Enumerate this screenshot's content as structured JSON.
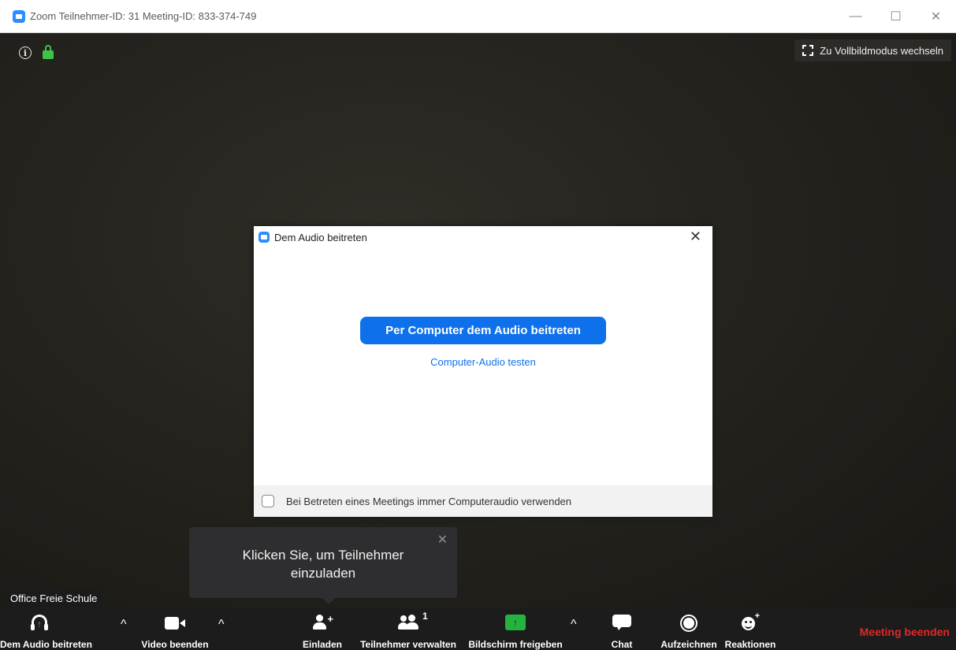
{
  "window": {
    "title": "Zoom Teilnehmer-ID: 31   Meeting-ID: 833-374-749",
    "minimize": "—",
    "maximize": "☐",
    "close": "✕"
  },
  "video": {
    "fullscreen_label": "Zu Vollbildmodus wechseln",
    "participant_name": "Office Freie Schule",
    "info_glyph": "i"
  },
  "tooltip": {
    "text": "Klicken Sie, um Teilnehmer einzuladen",
    "close": "✕"
  },
  "dialog": {
    "title": "Dem Audio beitreten",
    "close": "✕",
    "join_button": "Per Computer dem Audio beitreten",
    "test_link": "Computer-Audio testen",
    "checkbox_label": "Bei Betreten eines Meetings immer Computeraudio verwenden",
    "checkbox_checked": false
  },
  "toolbar": {
    "join_audio": "Dem Audio beitreten",
    "video": "Video beenden",
    "invite": "Einladen",
    "participants": "Teilnehmer verwalten",
    "participant_count": "1",
    "share": "Bildschirm freigeben",
    "chat": "Chat",
    "record": "Aufzeichnen",
    "reactions": "Reaktionen",
    "end_meeting": "Meeting beenden",
    "caret": "^"
  },
  "colors": {
    "accent": "#0e71eb",
    "share_green": "#25b33f",
    "end_red": "#e02828",
    "lock_green": "#3fc14a"
  },
  "icons": [
    "zoom-logo-icon",
    "info-icon",
    "lock-icon",
    "fullscreen-icon",
    "headphones-icon",
    "camera-icon",
    "person-add-icon",
    "people-icon",
    "share-screen-icon",
    "chat-icon",
    "record-icon",
    "reaction-icon",
    "caret-up-icon"
  ]
}
